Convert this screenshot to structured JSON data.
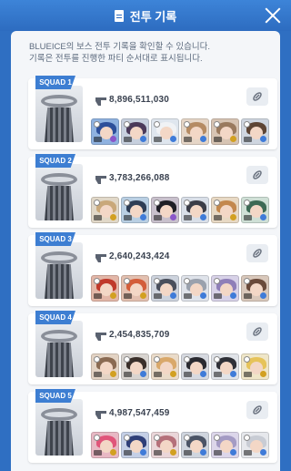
{
  "header": {
    "title": "전투 기록"
  },
  "intro": {
    "line1": "BLUEICE의 보스 전투 기록을 확인할 수 있습니다.",
    "line2": "기록은 전투를 진행한 파티 순서대로 표시됩니다."
  },
  "squads": [
    {
      "label": "SQUAD 1",
      "score": "8,896,511,030"
    },
    {
      "label": "SQUAD 2",
      "score": "3,783,266,088"
    },
    {
      "label": "SQUAD 3",
      "score": "2,640,243,424"
    },
    {
      "label": "SQUAD 4",
      "score": "2,454,835,709"
    },
    {
      "label": "SQUAD 5",
      "score": "4,987,547,459"
    }
  ],
  "colors": {
    "accent": "#3d7ed2",
    "header_bg": "#2f6fc2"
  }
}
